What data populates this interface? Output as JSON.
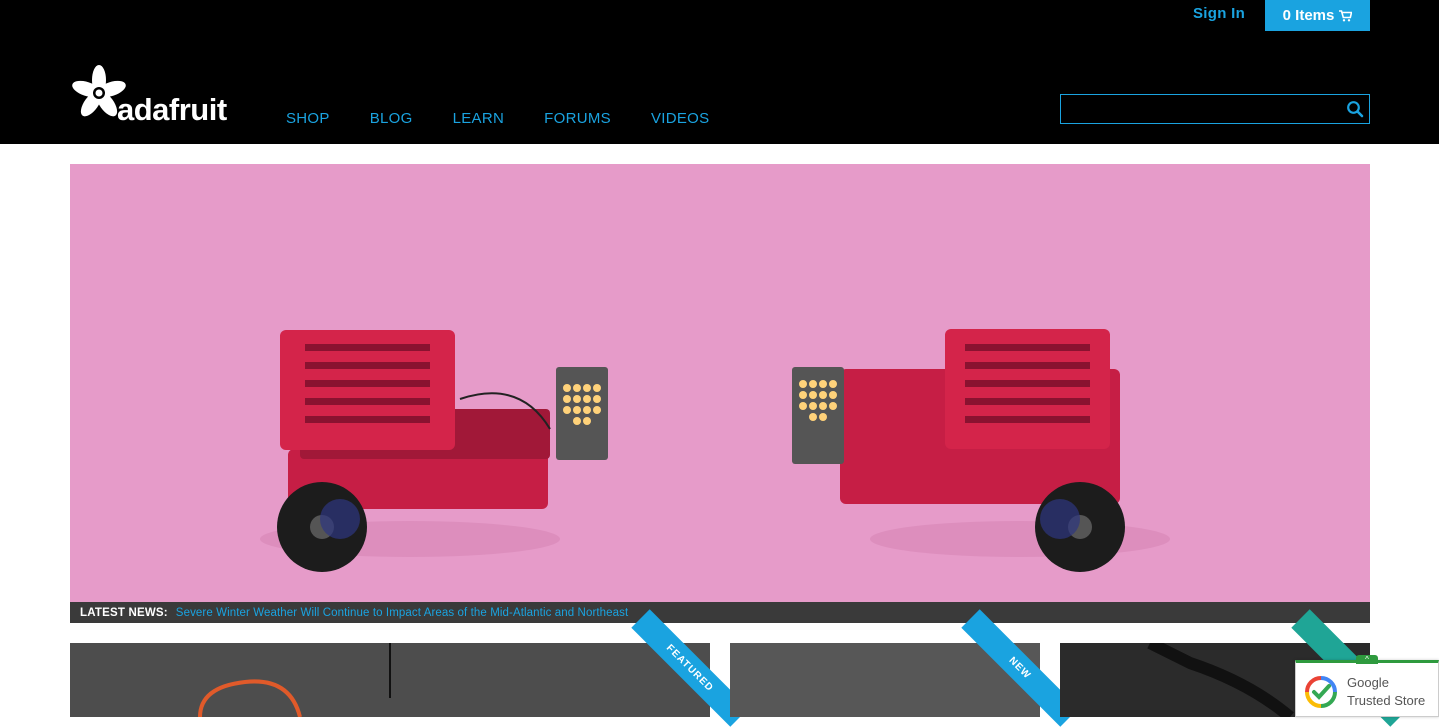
{
  "header": {
    "sign_in": "Sign In",
    "cart_label": "0 Items",
    "logo_text": "adafruit",
    "nav": [
      "SHOP",
      "BLOG",
      "LEARN",
      "FORUMS",
      "VIDEOS"
    ],
    "search_placeholder": ""
  },
  "news": {
    "label": "LATEST NEWS:",
    "headline": "Severe Winter Weather Will Continue to Impact Areas of the Mid-Atlantic and Northeast"
  },
  "cards": [
    {
      "ribbon": "FEATURED"
    },
    {
      "ribbon": "NEW"
    },
    {
      "ribbon": ""
    }
  ],
  "badge": {
    "line1": "Google",
    "line2": "Trusted Store"
  },
  "colors": {
    "accent": "#1aa3e0",
    "header_bg": "#000000",
    "hero_bg": "#e69bc9",
    "robot_red": "#d4244a"
  }
}
